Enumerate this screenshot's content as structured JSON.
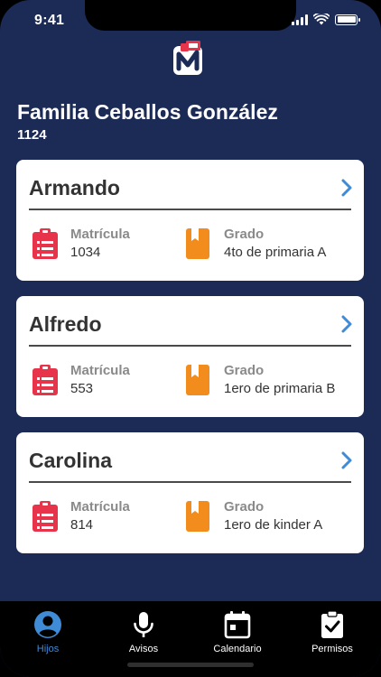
{
  "status_bar": {
    "time": "9:41"
  },
  "app": {
    "logo_icon": "app-logo"
  },
  "family": {
    "name": "Familia Ceballos González",
    "id": "1124"
  },
  "children": [
    {
      "name": "Armando",
      "matricula_label": "Matrícula",
      "matricula": "1034",
      "grado_label": "Grado",
      "grado": "4to de primaria A"
    },
    {
      "name": "Alfredo",
      "matricula_label": "Matrícula",
      "matricula": "553",
      "grado_label": "Grado",
      "grado": "1ero de primaria B"
    },
    {
      "name": "Carolina",
      "matricula_label": "Matrícula",
      "matricula": "814",
      "grado_label": "Grado",
      "grado": "1ero de kinder A"
    }
  ],
  "tabs": [
    {
      "label": "Hijos",
      "icon": "person-circle-icon",
      "active": true
    },
    {
      "label": "Avisos",
      "icon": "microphone-icon",
      "active": false
    },
    {
      "label": "Calendario",
      "icon": "calendar-icon",
      "active": false
    },
    {
      "label": "Permisos",
      "icon": "clipboard-check-icon",
      "active": false
    }
  ],
  "colors": {
    "background": "#1c2a56",
    "card": "#ffffff",
    "matricula_icon": "#e8344a",
    "grado_icon": "#f28c1d",
    "chevron": "#3f8bd6",
    "active_tab": "#3f8bd6"
  }
}
